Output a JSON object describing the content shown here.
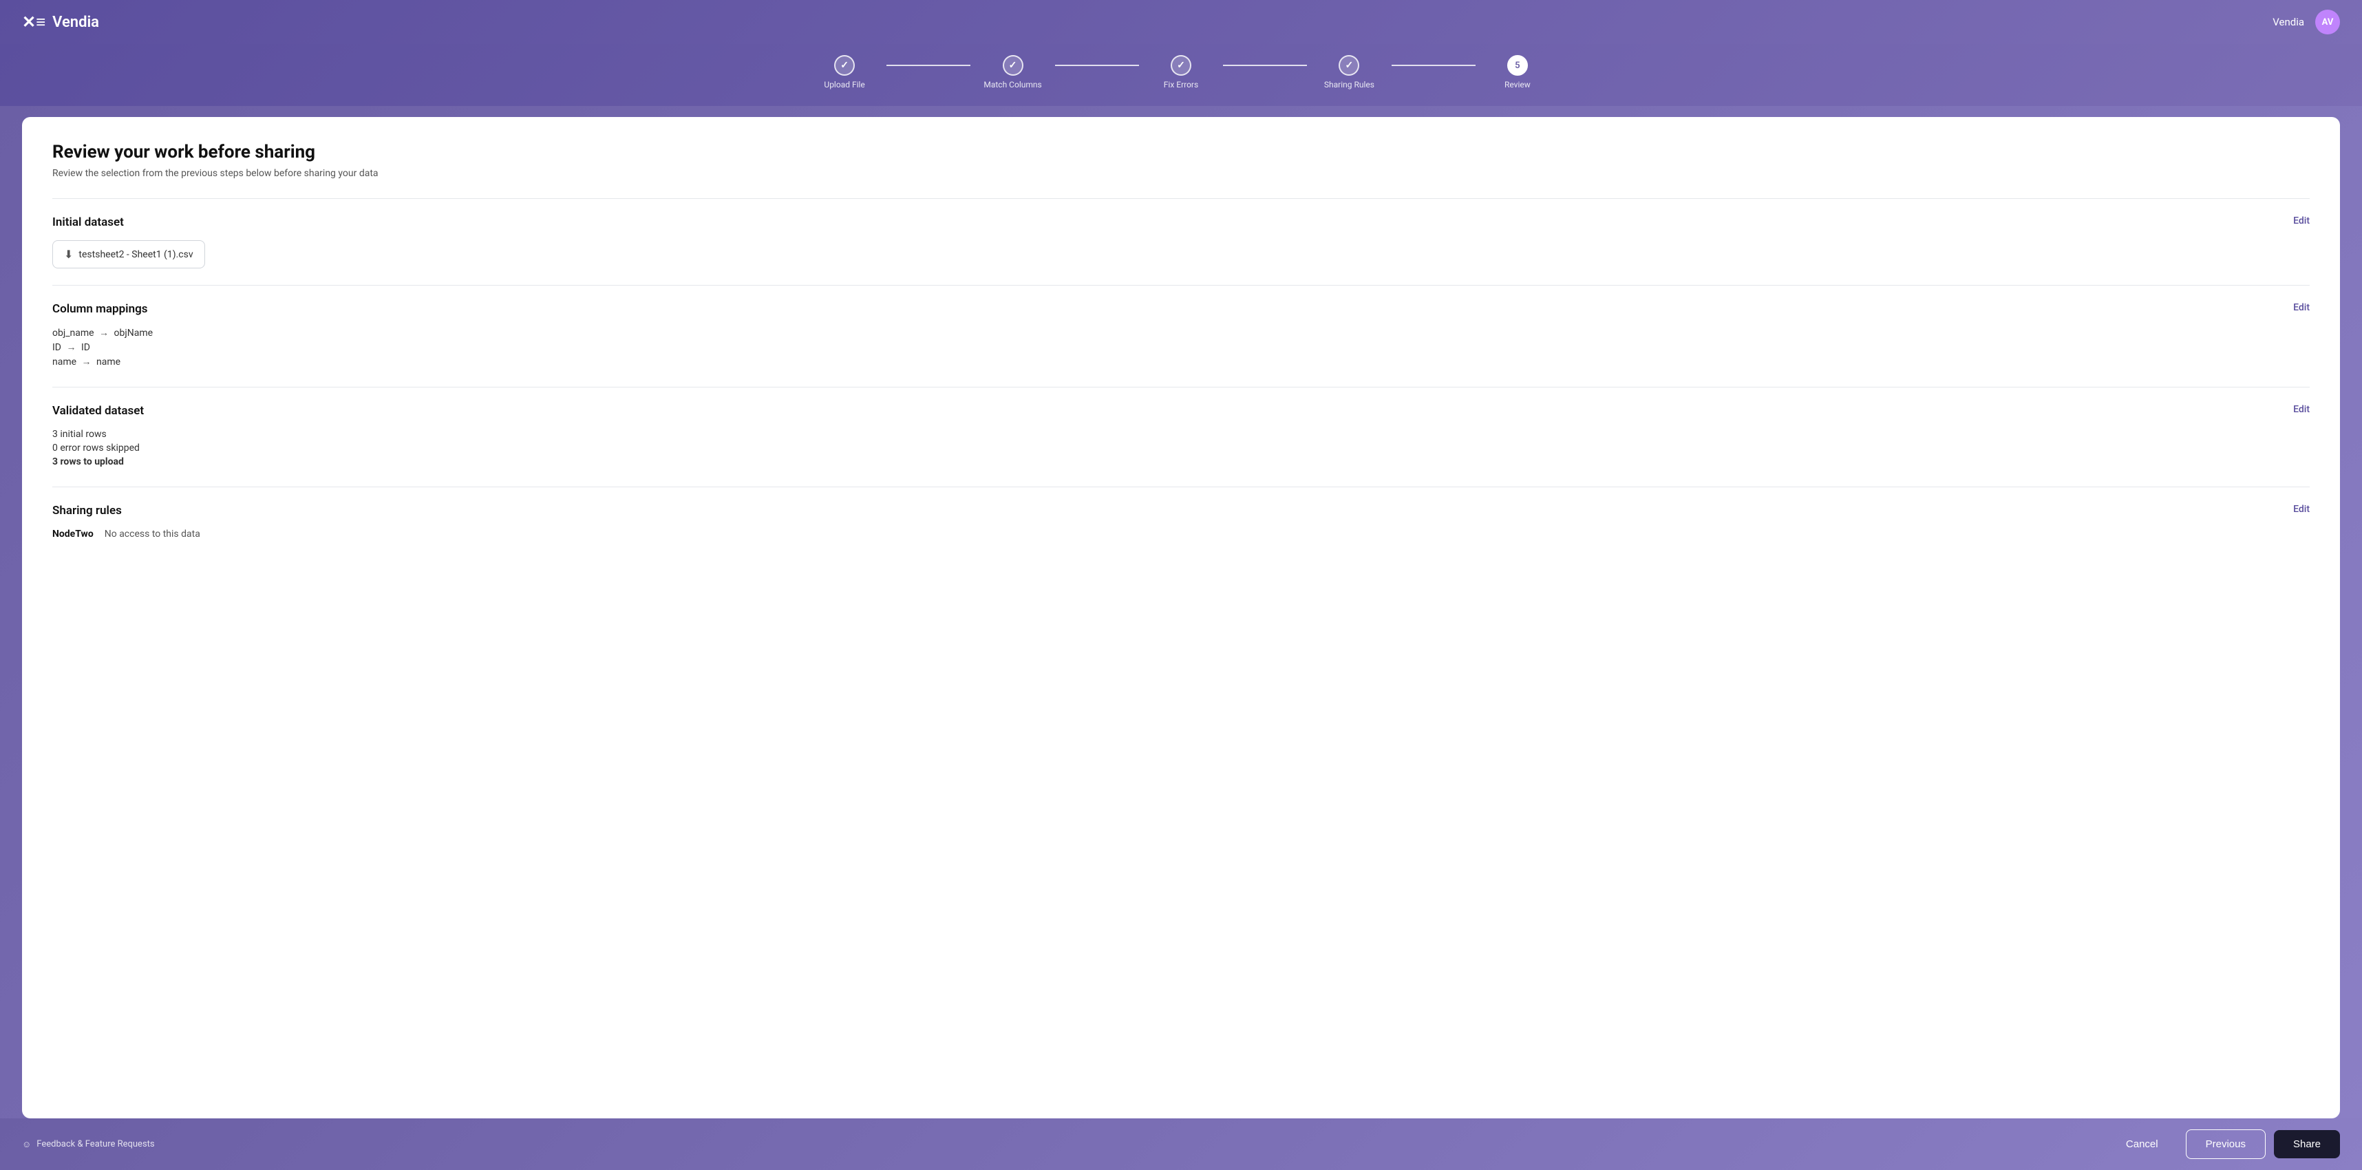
{
  "app": {
    "name": "Vendia",
    "logo_symbol": "✕≡",
    "user_initials": "AV"
  },
  "stepper": {
    "steps": [
      {
        "id": "upload-file",
        "label": "Upload File",
        "state": "completed",
        "symbol": "✓",
        "number": "1"
      },
      {
        "id": "match-columns",
        "label": "Match Columns",
        "state": "completed",
        "symbol": "✓",
        "number": "2"
      },
      {
        "id": "fix-errors",
        "label": "Fix Errors",
        "state": "completed",
        "symbol": "✓",
        "number": "3"
      },
      {
        "id": "sharing-rules",
        "label": "Sharing Rules",
        "state": "completed",
        "symbol": "✓",
        "number": "4"
      },
      {
        "id": "review",
        "label": "Review",
        "state": "active",
        "symbol": "5",
        "number": "5"
      }
    ]
  },
  "card": {
    "title": "Review your work before sharing",
    "subtitle": "Review the selection from the previous steps below before sharing your data"
  },
  "sections": {
    "initial_dataset": {
      "title": "Initial dataset",
      "edit_label": "Edit",
      "file_name": "testsheet2 - Sheet1 (1).csv"
    },
    "column_mappings": {
      "title": "Column mappings",
      "edit_label": "Edit",
      "mappings": [
        {
          "source": "obj_name",
          "target": "objName"
        },
        {
          "source": "ID",
          "target": "ID"
        },
        {
          "source": "name",
          "target": "name"
        }
      ]
    },
    "validated_dataset": {
      "title": "Validated dataset",
      "edit_label": "Edit",
      "stats": [
        {
          "text": "3 initial rows",
          "bold": false
        },
        {
          "text": "0 error rows skipped",
          "bold": false
        },
        {
          "text": "3 rows to upload",
          "bold": true
        }
      ]
    },
    "sharing_rules": {
      "title": "Sharing rules",
      "edit_label": "Edit",
      "rules": [
        {
          "node": "NodeTwo",
          "access": "No access to this data"
        }
      ]
    }
  },
  "footer": {
    "feedback_label": "Feedback & Feature Requests",
    "cancel_label": "Cancel",
    "previous_label": "Previous",
    "share_label": "Share"
  }
}
